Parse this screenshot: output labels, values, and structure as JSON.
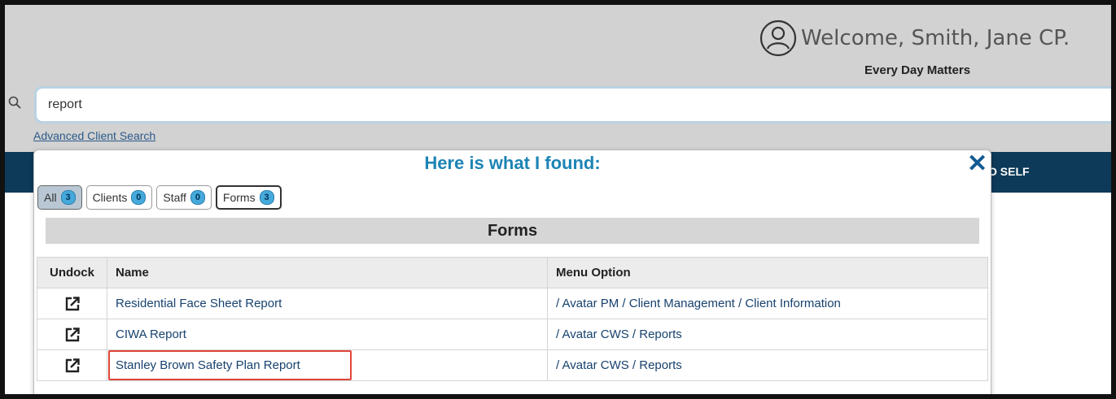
{
  "header": {
    "welcome": "Welcome, Smith, Jane CP.",
    "tagline": "Every Day Matters",
    "user_icon": "user-circle-icon"
  },
  "search": {
    "value": "report",
    "icon": "search-icon",
    "advanced_link": "Advanced Client Search"
  },
  "navbar": {
    "visible_text": "O SELF"
  },
  "popup": {
    "title": "Here is what I found:",
    "close_icon": "close-icon",
    "tabs": [
      {
        "label": "All",
        "count": "3",
        "active": true
      },
      {
        "label": "Clients",
        "count": "0",
        "active": false
      },
      {
        "label": "Staff",
        "count": "0",
        "active": false
      },
      {
        "label": "Forms",
        "count": "3",
        "active": false
      }
    ],
    "section_title": "Forms",
    "columns": [
      "Undock",
      "Name",
      "Menu Option"
    ],
    "rows": [
      {
        "undock_icon": "external-link-icon",
        "name": "Residential Face Sheet Report",
        "menu_option": "/ Avatar PM / Client Management / Client Information"
      },
      {
        "undock_icon": "external-link-icon",
        "name": "CIWA Report",
        "menu_option": "/ Avatar CWS / Reports"
      },
      {
        "undock_icon": "external-link-icon",
        "name": "Stanley Brown Safety Plan Report",
        "menu_option": "/ Avatar CWS / Reports"
      }
    ]
  },
  "colors": {
    "title_blue": "#1d84b5",
    "navbar": "#0d3a59",
    "badge": "#46a9dc",
    "highlight_red": "#e0453a"
  }
}
